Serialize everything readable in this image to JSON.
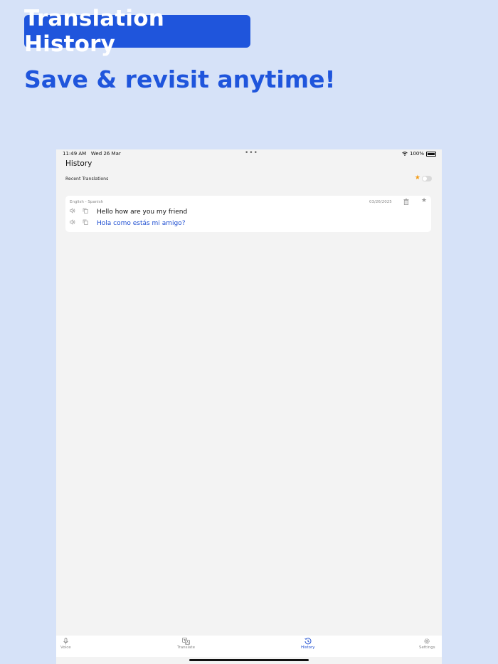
{
  "promo": {
    "badge": "Translation History",
    "headline": "Save & revisit anytime!"
  },
  "status_bar": {
    "time": "11:49 AM",
    "date": "Wed 26 Mar",
    "dots": "•••",
    "battery": "100%"
  },
  "screen": {
    "title": "History",
    "section_label": "Recent Translations"
  },
  "history": [
    {
      "languages": "English - Spanish",
      "date": "03/26/2025",
      "source_text": "Hello how are you my friend",
      "translated_text": "Hola como estás mi amigo?"
    }
  ],
  "tabs": [
    {
      "label": "Voice",
      "icon": "microphone-icon",
      "active": false
    },
    {
      "label": "Translate",
      "icon": "translate-icon",
      "active": false
    },
    {
      "label": "History",
      "icon": "history-icon",
      "active": true
    },
    {
      "label": "Settings",
      "icon": "gear-icon",
      "active": false
    }
  ],
  "colors": {
    "background": "#d6e2f8",
    "accent": "#1f55dc",
    "favorite_star": "#f39a13",
    "translation_text": "#1f4fd1"
  }
}
